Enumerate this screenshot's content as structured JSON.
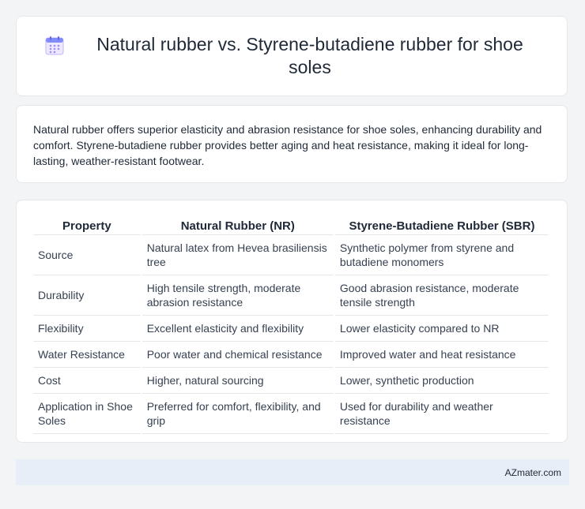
{
  "header": {
    "title": "Natural rubber vs. Styrene-butadiene rubber for shoe soles",
    "icon": "calendar-icon"
  },
  "summary": {
    "text": "Natural rubber offers superior elasticity and abrasion resistance for shoe soles, enhancing durability and comfort. Styrene-butadiene rubber provides better aging and heat resistance, making it ideal for long-lasting, weather-resistant footwear."
  },
  "table": {
    "headers": [
      "Property",
      "Natural Rubber (NR)",
      "Styrene-Butadiene Rubber (SBR)"
    ],
    "rows": [
      [
        "Source",
        "Natural latex from Hevea brasiliensis tree",
        "Synthetic polymer from styrene and butadiene monomers"
      ],
      [
        "Durability",
        "High tensile strength, moderate abrasion resistance",
        "Good abrasion resistance, moderate tensile strength"
      ],
      [
        "Flexibility",
        "Excellent elasticity and flexibility",
        "Lower elasticity compared to NR"
      ],
      [
        "Water Resistance",
        "Poor water and chemical resistance",
        "Improved water and heat resistance"
      ],
      [
        "Cost",
        "Higher, natural sourcing",
        "Lower, synthetic production"
      ],
      [
        "Application in Shoe Soles",
        "Preferred for comfort, flexibility, and grip",
        "Used for durability and weather resistance"
      ]
    ]
  },
  "footer": {
    "site": "AZmater.com"
  }
}
